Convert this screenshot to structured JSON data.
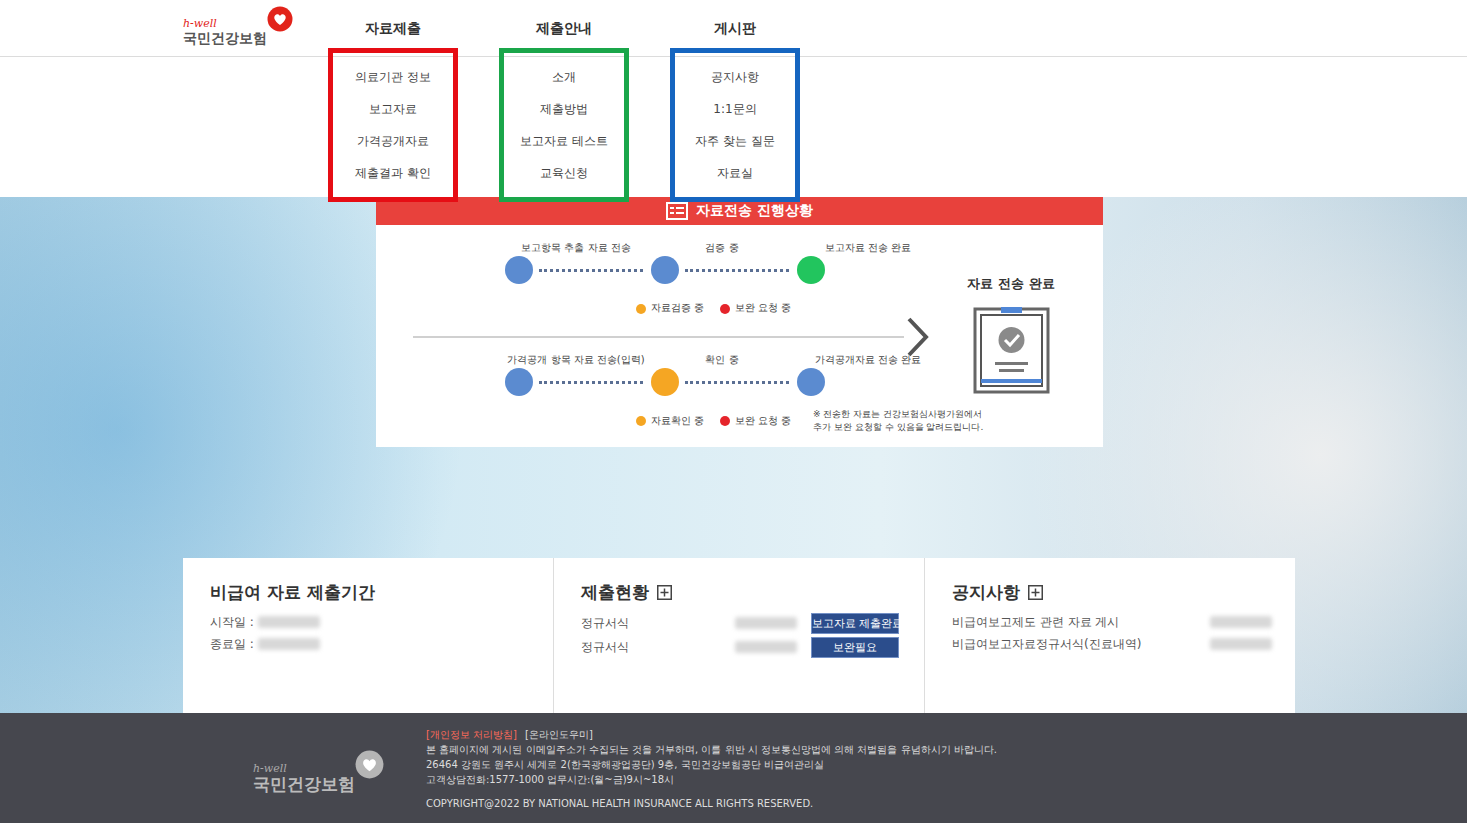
{
  "header": {
    "logo": {
      "tagline": "h-well",
      "name": "국민건강보험"
    },
    "nav": [
      {
        "title": "자료제출",
        "items": [
          "의료기관 정보",
          "보고자료",
          "가격공개자료",
          "제출결과 확인"
        ],
        "color": "#e60d14"
      },
      {
        "title": "제출안내",
        "items": [
          "소개",
          "제출방법",
          "보고자료 테스트",
          "교육신청"
        ],
        "color": "#1aa64a"
      },
      {
        "title": "게시판",
        "items": [
          "공지사항",
          "1:1문의",
          "자주 찾는 질문",
          "자료실"
        ],
        "color": "#1565c0"
      }
    ]
  },
  "progress": {
    "title": "자료전송 진행상황",
    "rows": [
      {
        "steps": [
          {
            "label": "보고항목 추출 자료 전송",
            "color": "#5b8bd0"
          },
          {
            "label": "검증 중",
            "color": "#5b8bd0"
          },
          {
            "label": "보고자료 전송 완료",
            "color": "#22c55e"
          }
        ],
        "legend": [
          {
            "label": "자료검증 중",
            "color": "#f5a623"
          },
          {
            "label": "보완 요청 중",
            "color": "#e5242b"
          }
        ],
        "note": []
      },
      {
        "steps": [
          {
            "label": "가격공개 항목 자료 전송(입력)",
            "color": "#5b8bd0"
          },
          {
            "label": "확인 중",
            "color": "#f5a623"
          },
          {
            "label": "가격공개자료 전송 완료",
            "color": "#5b8bd0"
          }
        ],
        "legend": [
          {
            "label": "자료확인 중",
            "color": "#f5a623"
          },
          {
            "label": "보완 요청 중",
            "color": "#e5242b"
          }
        ],
        "note": [
          "※ 전송한 자료는 건강보험심사평가원에서",
          "추가 보완 요청할 수 있음을 알려드립니다."
        ]
      }
    ],
    "complete": "자료 전송 완료"
  },
  "cards": [
    {
      "kind": "period",
      "title": "비급여 자료 제출기간",
      "rows": [
        {
          "label": "시작일 :"
        },
        {
          "label": "종료일 :"
        }
      ]
    },
    {
      "kind": "status",
      "title": "제출현황",
      "rows": [
        {
          "label": "정규서식",
          "badge": "보고자료 제출완료"
        },
        {
          "label": "정규서식",
          "badge": "보완필요"
        }
      ]
    },
    {
      "kind": "notice",
      "title": "공지사항",
      "rows": [
        {
          "label": "비급여보고제도 관련 자료 게시"
        },
        {
          "label": "비급여보고자료정규서식(진료내역)"
        }
      ]
    }
  ],
  "footer": {
    "logo": {
      "tagline": "h-well",
      "name": "국민건강보험"
    },
    "links": [
      {
        "label": "[개인정보 처리방침]",
        "color": "#ff6b5a"
      },
      {
        "label": "[온라인도우미]",
        "color": "#dddddd"
      }
    ],
    "lines": [
      "본 홈페이지에 게시된 이메일주소가 수집되는 것을 거부하며, 이를 위반 시 정보통신망법에 의해 처벌됨을 유념하시기 바랍니다.",
      "26464 강원도 원주시 세계로 2(한국광해광업공단) 9층, 국민건강보험공단 비급여관리실",
      "고객상담전화:1577-1000 업무시간:(월~금)9시~18시"
    ],
    "copyright": "COPYRIGHT@2022 BY NATIONAL HEALTH INSURANCE ALL RIGHTS RESERVED."
  }
}
